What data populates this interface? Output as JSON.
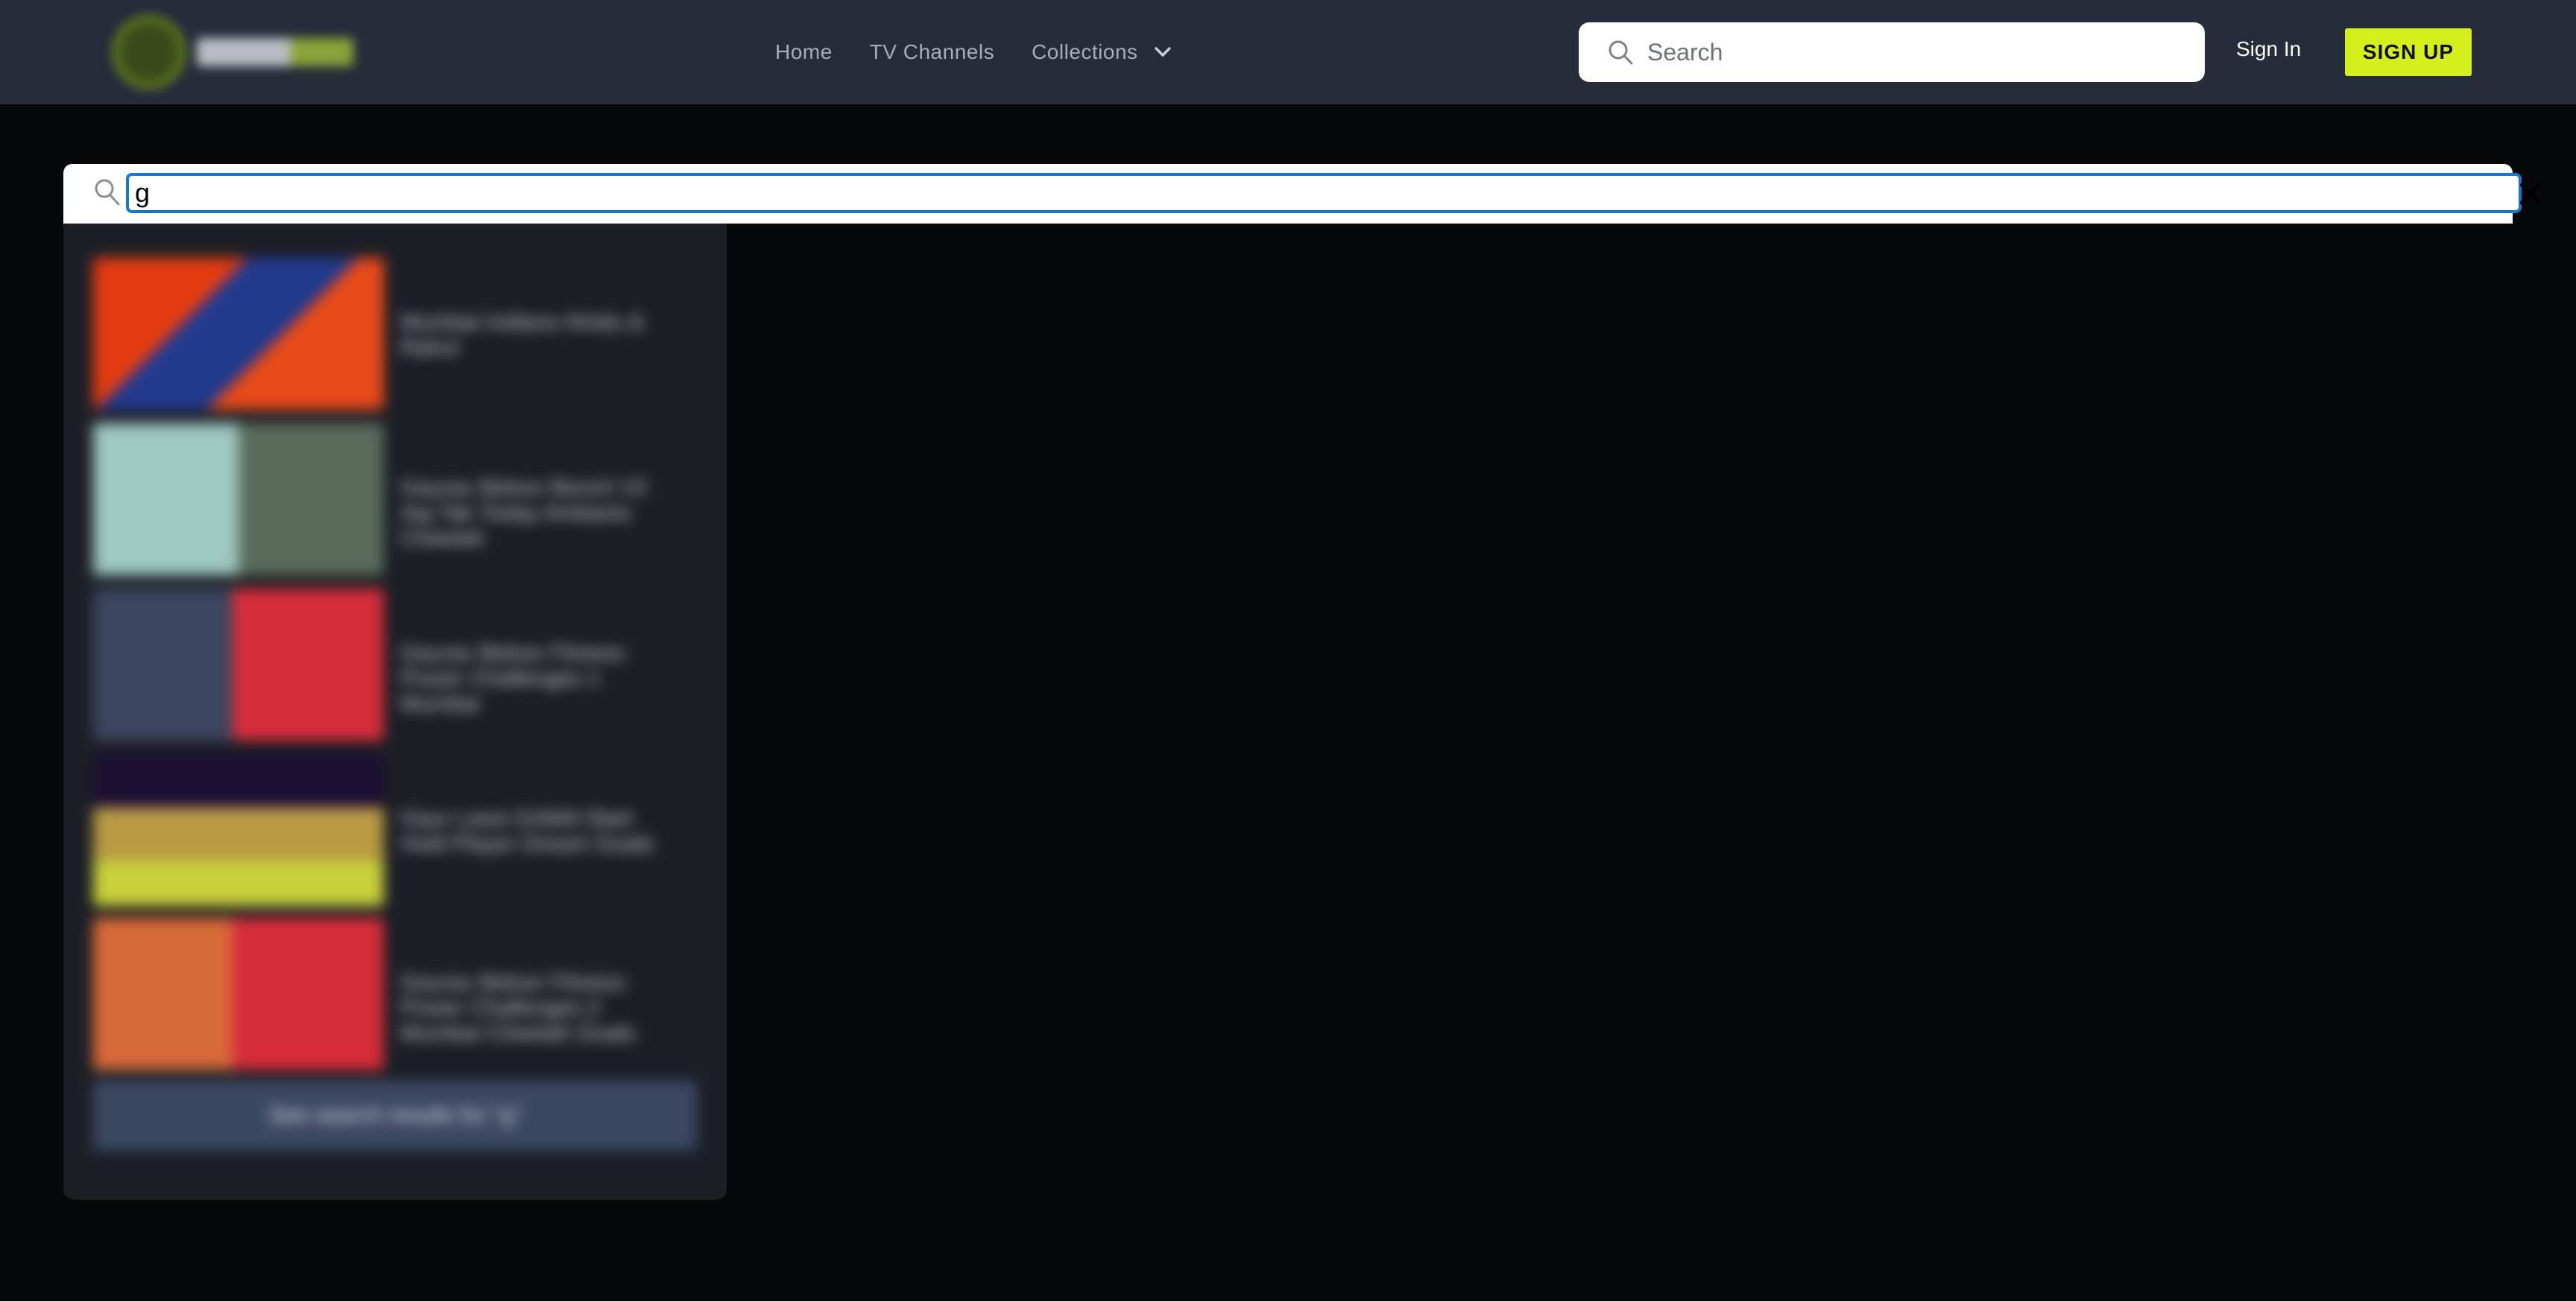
{
  "header": {
    "logo_text": "NEOSN TV",
    "nav": {
      "home": "Home",
      "tv_channels": "TV Channels",
      "collections": "Collections"
    },
    "search_placeholder": "Search",
    "sign_in": "Sign In",
    "sign_up": "SIGN UP",
    "accent_color": "#d4f01c"
  },
  "search_overlay": {
    "query": "g"
  },
  "results": {
    "items": [
      {
        "title": "Mumbai Indians Hindu & Rahul"
      },
      {
        "title": "Gaurav Beloor Bench V2 Aaj Tak Today Ambanis Cheetah"
      },
      {
        "title": "Gaurav Beloor Fitness: Power Challenges 1 Mumbai"
      },
      {
        "title": "Gaur Lassi GAMA Start Hold Player Dream Goals"
      },
      {
        "title": "Gaurav Beloor Fitness: Power Challenges 2 Mumbai Cheetah Goals"
      }
    ],
    "see_all": "See search results for \"g\""
  }
}
